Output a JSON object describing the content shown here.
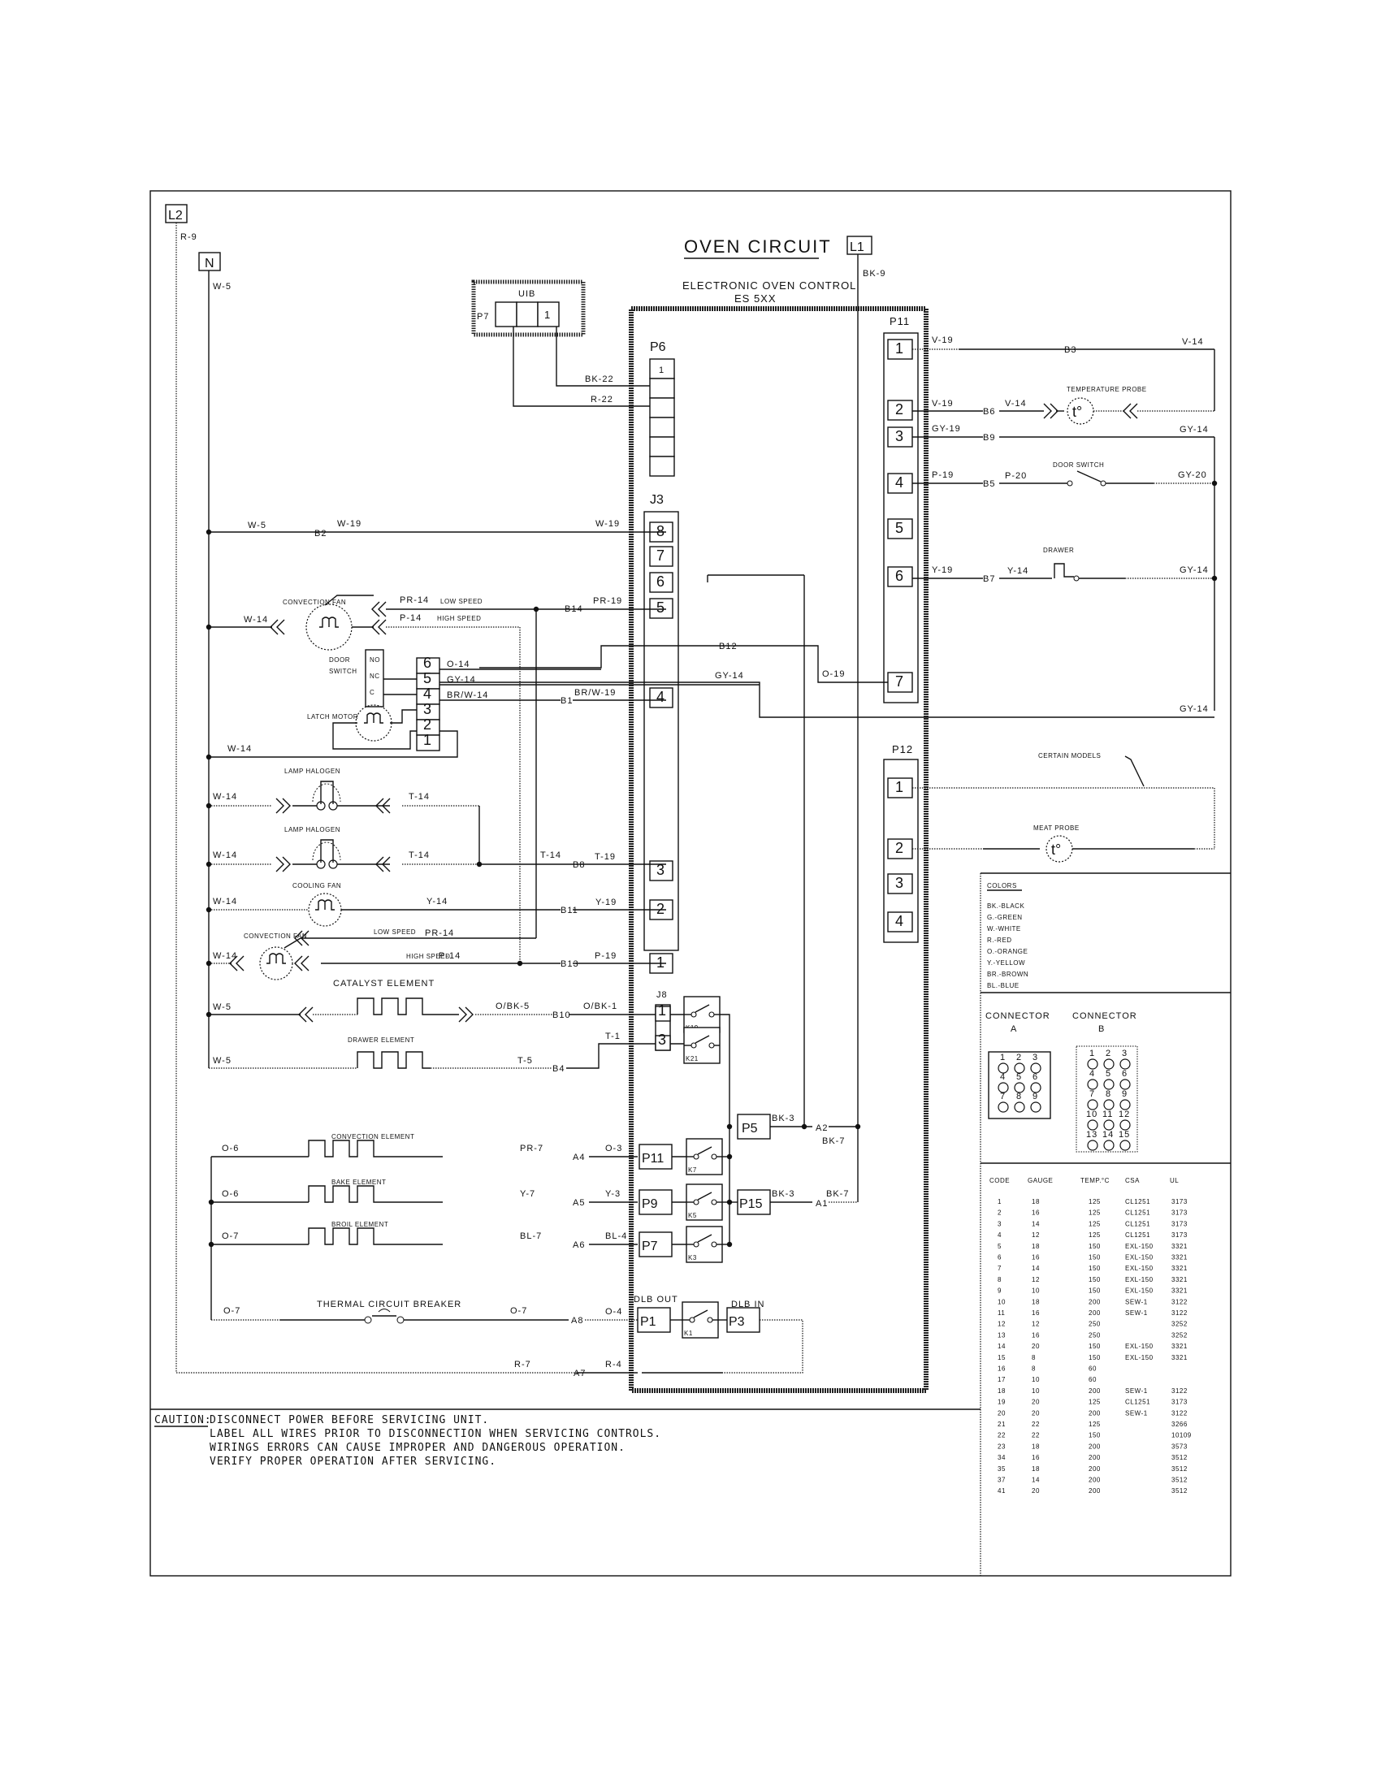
{
  "title": "OVEN CIRCUIT",
  "control": {
    "name": "ELECTRONIC OVEN CONTROL",
    "model": "ES 5XX"
  },
  "power": {
    "l1": {
      "label": "L1",
      "wire": "BK-9"
    },
    "l2": {
      "label": "L2",
      "wire": "R-9"
    },
    "n": {
      "label": "N",
      "wire": "W-5"
    }
  },
  "uib": {
    "label": "UIB",
    "connector": "P7",
    "pin": "1",
    "wires": [
      "BK-22",
      "R-22"
    ]
  },
  "p6": {
    "label": "P6",
    "pins": [
      "1",
      "",
      "",
      "",
      "",
      ""
    ]
  },
  "j3": {
    "label": "J3",
    "pins": [
      "8",
      "7",
      "6",
      "5",
      "4",
      "3",
      "2",
      "1"
    ]
  },
  "p11_connector": {
    "label": "P11",
    "pins": [
      "1",
      "2",
      "3",
      "4",
      "5",
      "6",
      "7"
    ]
  },
  "p12": {
    "label": "P12",
    "pins": [
      "1",
      "2",
      "3",
      "4"
    ]
  },
  "j8": {
    "label": "J8",
    "pins": [
      "1",
      "3"
    ]
  },
  "right_circuits": [
    {
      "pin": "1",
      "wire_in": "V-19",
      "splice": "B3",
      "wire_out": "V-14"
    },
    {
      "pin": "2",
      "wire_in": "V-19",
      "splice": "B6",
      "wire_mid": "V-14",
      "component": "TEMPERATURE PROBE",
      "symbol": "t°"
    },
    {
      "pin": "3",
      "wire_in": "GY-19",
      "splice": "B9",
      "wire_out": "GY-14"
    },
    {
      "pin": "4",
      "wire_in": "P-19",
      "splice": "B5",
      "wire_mid": "P-20",
      "component": "DOOR SWITCH",
      "wire_out": "GY-20"
    },
    {
      "pin": "6",
      "wire_in": "Y-19",
      "splice": "B7",
      "wire_mid": "Y-14",
      "component": "DRAWER",
      "wire_out": "GY-14"
    },
    {
      "pin": "7",
      "wire_in": "O-19",
      "splice": "B12",
      "wire_out": "GY-14"
    }
  ],
  "meat_probe": {
    "label": "MEAT PROBE",
    "symbol": "t°",
    "note": "CERTAIN MODELS"
  },
  "left_circuits": {
    "b2": {
      "wire_a": "W-5",
      "splice": "B2",
      "wire_b": "W-19",
      "wire_c": "W-19"
    },
    "conv_fan_top": {
      "label": "CONVECTION FAN",
      "neutral": "W-14",
      "low": "PR-14",
      "low_tag": "LOW SPEED",
      "high": "P-14",
      "high_tag": "HIGH SPEED",
      "splice": "B14",
      "wire_ctrl": "PR-19"
    },
    "door_switch": {
      "label_1": "DOOR",
      "label_2": "SWITCH",
      "contacts": [
        "NO",
        "NC",
        "C"
      ],
      "pins": [
        "6",
        "5",
        "4",
        "3",
        "2",
        "1"
      ],
      "wires": [
        "O-14",
        "GY-14",
        "BR/W-14"
      ],
      "splice": "B1",
      "wire_ctrl": "BR/W-19"
    },
    "latch_motor": {
      "label": "LATCH MOTOR",
      "neutral": "W-14"
    },
    "lamp1": {
      "label": "LAMP HALOGEN",
      "neutral": "W-14",
      "hot": "T-14"
    },
    "lamp2": {
      "label": "LAMP HALOGEN",
      "neutral": "W-14",
      "hot": "T-14",
      "wire_b": "T-14",
      "splice": "B8",
      "wire_ctrl": "T-19"
    },
    "cooling_fan": {
      "label": "COOLING FAN",
      "neutral": "W-14",
      "hot": "Y-14",
      "splice": "B11",
      "wire_ctrl": "Y-19"
    },
    "conv_fan_bottom": {
      "label": "CONVECTION FAN",
      "neutral": "W-14",
      "low_tag": "LOW SPEED",
      "low": "PR-14",
      "high_tag": "HIGH SPEED",
      "high": "P-14",
      "splice": "B13",
      "wire_ctrl": "P-19"
    },
    "catalyst": {
      "label": "CATALYST ELEMENT",
      "neutral": "W-5",
      "hot": "O/BK-5",
      "splice": "B10",
      "wire_ctrl": "O/BK-1",
      "relay": "K19"
    },
    "drawer_element": {
      "label": "DRAWER ELEMENT",
      "neutral": "W-5",
      "hot": "T-5",
      "splice": "B4",
      "wire_ctrl": "T-1",
      "relay": "K21"
    }
  },
  "elements": [
    {
      "label": "CONVECTION ELEMENT",
      "wire_l": "O-6",
      "wire_r": "PR-7",
      "splice": "A4",
      "wire_ctrl": "O-3",
      "connector": "P11",
      "relay": "K7"
    },
    {
      "label": "BAKE ELEMENT",
      "wire_l": "O-6",
      "wire_r": "Y-7",
      "splice": "A5",
      "wire_ctrl": "Y-3",
      "connector": "P9",
      "relay": "K5"
    },
    {
      "label": "BROIL ELEMENT",
      "wire_l": "O-7",
      "wire_r": "BL-7",
      "splice": "A6",
      "wire_ctrl": "BL-4",
      "connector": "P7",
      "relay": "K3"
    }
  ],
  "relay_bus": {
    "p5": {
      "label": "P5",
      "wire": "BK-3",
      "splice": "A2",
      "wire_out": "BK-7"
    },
    "p15": {
      "label": "P15",
      "wire": "BK-3",
      "splice": "A1",
      "wire_out": "BK-7"
    }
  },
  "breaker": {
    "label": "THERMAL CIRCUIT BREAKER",
    "wire_l": "O-7",
    "wire_r": "O-7",
    "splice": "A8",
    "wire_ctrl": "O-4",
    "out_label": "DLB OUT",
    "in_label": "DLB IN",
    "p_out": "P1",
    "p_in": "P3",
    "relay": "K1"
  },
  "return": {
    "wire": "R-7",
    "splice": "A7",
    "wire_ctrl": "R-4"
  },
  "caution": {
    "prefix": "CAUTION:",
    "lines": [
      "DISCONNECT POWER BEFORE SERVICING UNIT.",
      "LABEL ALL WIRES PRIOR TO DISCONNECTION WHEN SERVICING CONTROLS.",
      "WIRINGS ERRORS CAN CAUSE IMPROPER AND DANGEROUS OPERATION.",
      "VERIFY PROPER OPERATION AFTER SERVICING."
    ]
  },
  "colors_legend": {
    "title": "COLORS",
    "items": [
      "BK.-BLACK",
      "G.-GREEN",
      "W.-WHITE",
      "R.-RED",
      "O.-ORANGE",
      "Y.-YELLOW",
      "BR.-BROWN",
      "BL.-BLUE"
    ]
  },
  "connectors_legend": {
    "a": {
      "title": "CONNECTOR",
      "sub": "A",
      "pins": [
        "1",
        "2",
        "3",
        "4",
        "5",
        "6",
        "7",
        "8",
        "9"
      ]
    },
    "b": {
      "title": "CONNECTOR",
      "sub": "B",
      "pins": [
        "1",
        "2",
        "3",
        "4",
        "5",
        "6",
        "7",
        "8",
        "9",
        "10",
        "11",
        "12",
        "13",
        "14",
        "15"
      ]
    }
  },
  "gauge_table": {
    "headers": [
      "CODE",
      "GAUGE",
      "TEMP.°C",
      "CSA",
      "UL"
    ],
    "rows": [
      [
        "1",
        "18",
        "125",
        "CL1251",
        "3173"
      ],
      [
        "2",
        "16",
        "125",
        "CL1251",
        "3173"
      ],
      [
        "3",
        "14",
        "125",
        "CL1251",
        "3173"
      ],
      [
        "4",
        "12",
        "125",
        "CL1251",
        "3173"
      ],
      [
        "5",
        "18",
        "150",
        "EXL-150",
        "3321"
      ],
      [
        "6",
        "16",
        "150",
        "EXL-150",
        "3321"
      ],
      [
        "7",
        "14",
        "150",
        "EXL-150",
        "3321"
      ],
      [
        "8",
        "12",
        "150",
        "EXL-150",
        "3321"
      ],
      [
        "9",
        "10",
        "150",
        "EXL-150",
        "3321"
      ],
      [
        "10",
        "18",
        "200",
        "SEW-1",
        "3122"
      ],
      [
        "11",
        "16",
        "200",
        "SEW-1",
        "3122"
      ],
      [
        "12",
        "12",
        "250",
        "",
        "3252"
      ],
      [
        "13",
        "16",
        "250",
        "",
        "3252"
      ],
      [
        "14",
        "20",
        "150",
        "EXL-150",
        "3321"
      ],
      [
        "15",
        "8",
        "150",
        "EXL-150",
        "3321"
      ],
      [
        "16",
        "8",
        "60",
        "",
        ""
      ],
      [
        "17",
        "10",
        "60",
        "",
        ""
      ],
      [
        "18",
        "10",
        "200",
        "SEW-1",
        "3122"
      ],
      [
        "19",
        "20",
        "125",
        "CL1251",
        "3173"
      ],
      [
        "20",
        "20",
        "200",
        "SEW-1",
        "3122"
      ],
      [
        "21",
        "22",
        "125",
        "",
        "3266"
      ],
      [
        "22",
        "22",
        "150",
        "",
        "10109"
      ],
      [
        "23",
        "18",
        "200",
        "",
        "3573"
      ],
      [
        "34",
        "16",
        "200",
        "",
        "3512"
      ],
      [
        "35",
        "18",
        "200",
        "",
        "3512"
      ],
      [
        "37",
        "14",
        "200",
        "",
        "3512"
      ],
      [
        "41",
        "20",
        "200",
        "",
        "3512"
      ]
    ]
  }
}
